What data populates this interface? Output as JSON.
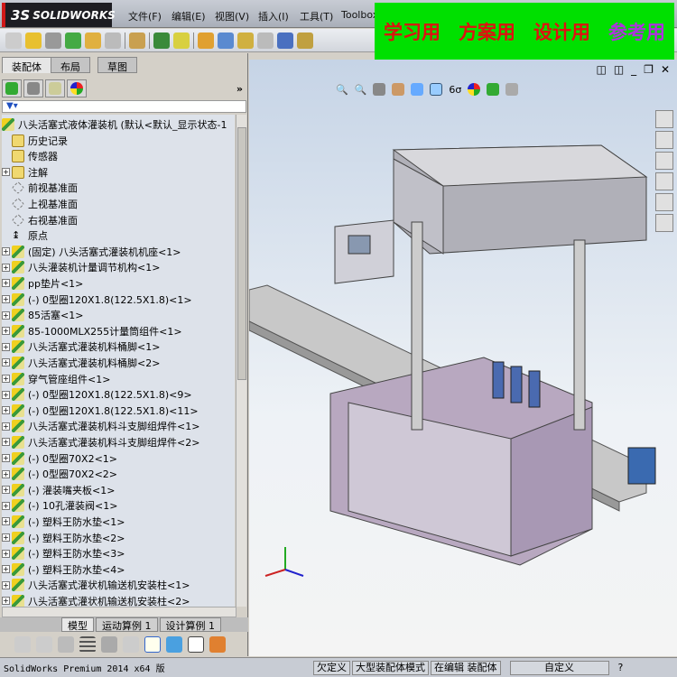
{
  "app": {
    "logo": "SOLIDWORKS"
  },
  "menu": [
    "文件(F)",
    "编辑(E)",
    "视图(V)",
    "插入(I)",
    "工具(T)",
    "Toolbox"
  ],
  "banner": {
    "items": [
      {
        "text": "学习用",
        "color": "#e01010"
      },
      {
        "text": "方案用",
        "color": "#e01010"
      },
      {
        "text": "设计用",
        "color": "#e01010"
      },
      {
        "text": "参考用",
        "color": "#b030e0"
      }
    ]
  },
  "panel_tabs": [
    "装配体",
    "布局",
    "草图"
  ],
  "feature_tree": {
    "root": "八头活塞式液体灌装机  (默认<默认_显示状态-1",
    "items": [
      {
        "label": "历史记录",
        "icon": "history-folder",
        "expand": false
      },
      {
        "label": "传感器",
        "icon": "sensor-folder",
        "expand": false
      },
      {
        "label": "注解",
        "icon": "annotation-folder",
        "expand": true
      },
      {
        "label": "前视基准面",
        "icon": "plane",
        "expand": false
      },
      {
        "label": "上视基准面",
        "icon": "plane",
        "expand": false
      },
      {
        "label": "右视基准面",
        "icon": "plane",
        "expand": false
      },
      {
        "label": "原点",
        "icon": "origin",
        "expand": false
      },
      {
        "label": "(固定) 八头活塞式灌装机机座<1>",
        "icon": "component",
        "expand": true
      },
      {
        "label": "八头灌装机计量调节机构<1>",
        "icon": "component",
        "expand": true
      },
      {
        "label": "pp垫片<1>",
        "icon": "component",
        "expand": true
      },
      {
        "label": "(-) 0型圈120X1.8(122.5X1.8)<1>",
        "icon": "component",
        "expand": true
      },
      {
        "label": "85活塞<1>",
        "icon": "component",
        "expand": true
      },
      {
        "label": "85-1000MLX255计量筒组件<1>",
        "icon": "component",
        "expand": true
      },
      {
        "label": "八头活塞式灌装机料桶脚<1>",
        "icon": "component",
        "expand": true
      },
      {
        "label": "八头活塞式灌装机料桶脚<2>",
        "icon": "component",
        "expand": true
      },
      {
        "label": "穿气管座组件<1>",
        "icon": "component",
        "expand": true
      },
      {
        "label": "(-) 0型圈120X1.8(122.5X1.8)<9>",
        "icon": "component",
        "expand": true
      },
      {
        "label": "(-) 0型圈120X1.8(122.5X1.8)<11>",
        "icon": "component",
        "expand": true
      },
      {
        "label": "八头活塞式灌装机料斗支脚组焊件<1>",
        "icon": "component",
        "expand": true
      },
      {
        "label": "八头活塞式灌装机料斗支脚组焊件<2>",
        "icon": "component",
        "expand": true
      },
      {
        "label": "(-) 0型圈70X2<1>",
        "icon": "component",
        "expand": true
      },
      {
        "label": "(-) 0型圈70X2<2>",
        "icon": "component",
        "expand": true
      },
      {
        "label": "(-) 灌装嘴夹板<1>",
        "icon": "component",
        "expand": true
      },
      {
        "label": "(-) 10孔灌装阀<1>",
        "icon": "component",
        "expand": true
      },
      {
        "label": "(-) 塑料王防水垫<1>",
        "icon": "component",
        "expand": true
      },
      {
        "label": "(-) 塑料王防水垫<2>",
        "icon": "component",
        "expand": true
      },
      {
        "label": "(-) 塑料王防水垫<3>",
        "icon": "component",
        "expand": true
      },
      {
        "label": "(-) 塑料王防水垫<4>",
        "icon": "component",
        "expand": true
      },
      {
        "label": "八头活塞式灌状机输送机安装柱<1>",
        "icon": "component",
        "expand": true
      },
      {
        "label": "八头活塞式灌状机输送机安装柱<2>",
        "icon": "component",
        "expand": true
      }
    ]
  },
  "bottom_tabs": [
    "模型",
    "运动算例 1",
    "设计算例 1"
  ],
  "status": {
    "product": "SolidWorks Premium 2014 x64 版",
    "cells": [
      "欠定义",
      "大型装配体模式",
      "在编辑 装配体",
      "自定义"
    ],
    "help": "?"
  }
}
